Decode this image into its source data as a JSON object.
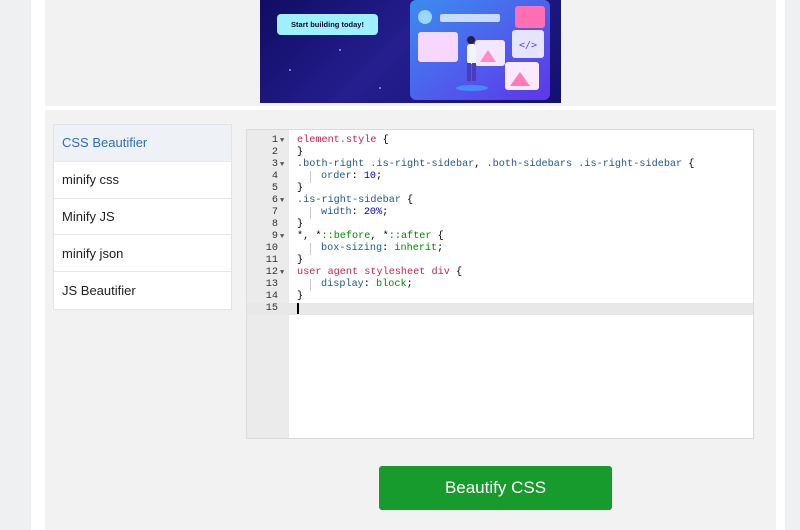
{
  "banner": {
    "cta_label": "Start building today!"
  },
  "sidebar": {
    "items": [
      {
        "label": "CSS Beautifier"
      },
      {
        "label": "minify css"
      },
      {
        "label": "Minify JS"
      },
      {
        "label": "minify json"
      },
      {
        "label": "JS Beautifier"
      }
    ]
  },
  "editor": {
    "lines": [
      {
        "n": "1",
        "fold": true,
        "segs": [
          [
            "sel",
            "element.style"
          ],
          [
            "txt",
            " {"
          ]
        ]
      },
      {
        "n": "2",
        "fold": false,
        "segs": [
          [
            "txt",
            "}"
          ]
        ]
      },
      {
        "n": "3",
        "fold": true,
        "segs": [
          [
            "sel2",
            ".both-right .is-right-sidebar"
          ],
          [
            "txt",
            ", "
          ],
          [
            "sel2",
            ".both-sidebars .is-right-sidebar"
          ],
          [
            "txt",
            " {"
          ]
        ]
      },
      {
        "n": "4",
        "fold": false,
        "indent": true,
        "segs": [
          [
            "prop",
            "order"
          ],
          [
            "txt",
            ": "
          ],
          [
            "val",
            "10"
          ],
          [
            "txt",
            ";"
          ]
        ]
      },
      {
        "n": "5",
        "fold": false,
        "segs": [
          [
            "txt",
            "}"
          ]
        ]
      },
      {
        "n": "6",
        "fold": true,
        "segs": [
          [
            "sel2",
            ".is-right-sidebar"
          ],
          [
            "txt",
            " {"
          ]
        ]
      },
      {
        "n": "7",
        "fold": false,
        "indent": true,
        "segs": [
          [
            "prop",
            "width"
          ],
          [
            "txt",
            ": "
          ],
          [
            "val",
            "20%"
          ],
          [
            "txt",
            ";"
          ]
        ]
      },
      {
        "n": "8",
        "fold": false,
        "segs": [
          [
            "txt",
            "}"
          ]
        ]
      },
      {
        "n": "9",
        "fold": true,
        "segs": [
          [
            "txt",
            "*, *"
          ],
          [
            "kw",
            "::before"
          ],
          [
            "txt",
            ", *"
          ],
          [
            "kw",
            "::after"
          ],
          [
            "txt",
            " {"
          ]
        ]
      },
      {
        "n": "10",
        "fold": false,
        "indent": true,
        "segs": [
          [
            "prop",
            "box-sizing"
          ],
          [
            "txt",
            ": "
          ],
          [
            "kw",
            "inherit"
          ],
          [
            "txt",
            ";"
          ]
        ]
      },
      {
        "n": "11",
        "fold": false,
        "segs": [
          [
            "txt",
            "}"
          ]
        ]
      },
      {
        "n": "12",
        "fold": true,
        "segs": [
          [
            "sel",
            "user agent stylesheet div"
          ],
          [
            "txt",
            " {"
          ]
        ]
      },
      {
        "n": "13",
        "fold": false,
        "indent": true,
        "segs": [
          [
            "prop",
            "display"
          ],
          [
            "txt",
            ": "
          ],
          [
            "kw",
            "block"
          ],
          [
            "txt",
            ";"
          ]
        ]
      },
      {
        "n": "14",
        "fold": false,
        "segs": [
          [
            "txt",
            "}"
          ]
        ]
      },
      {
        "n": "15",
        "fold": false,
        "active": true,
        "segs": []
      }
    ]
  },
  "actions": {
    "beautify_label": "Beautify CSS"
  },
  "colors": {
    "button": "#179b2c",
    "active_tab_text": "#2f6fb3"
  }
}
